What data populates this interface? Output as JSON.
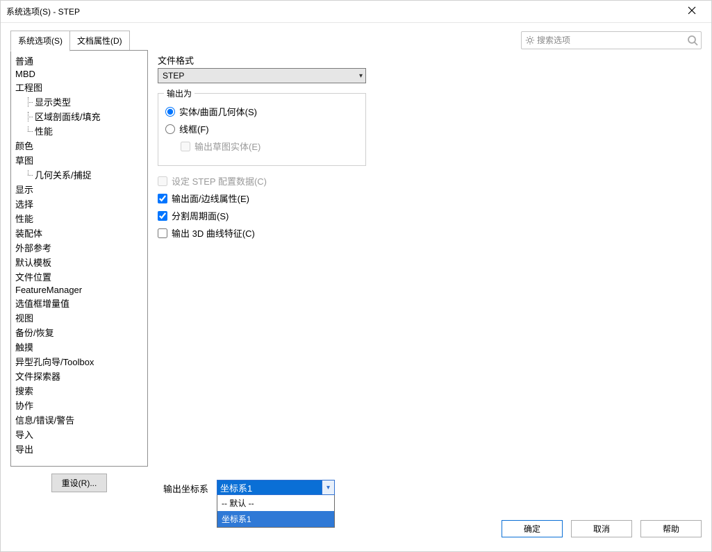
{
  "window": {
    "title": "系统选项(S) - STEP"
  },
  "tabs": {
    "system": "系统选项(S)",
    "docprops": "文档属性(D)"
  },
  "search": {
    "placeholder": "搜索选项"
  },
  "tree": {
    "items": [
      "普通",
      "MBD",
      "工程图",
      "颜色",
      "草图",
      "显示",
      "选择",
      "性能",
      "装配体",
      "外部参考",
      "默认模板",
      "文件位置",
      "FeatureManager",
      "选值框增量值",
      "视图",
      "备份/恢复",
      "触摸",
      "异型孔向导/Toolbox",
      "文件探索器",
      "搜索",
      "协作",
      "信息/错误/警告",
      "导入",
      "导出"
    ],
    "drawing_children": [
      "显示类型",
      "区域剖面线/填充",
      "性能"
    ],
    "sketch_children": [
      "几何关系/捕捉"
    ]
  },
  "reset_label": "重设(R)...",
  "main": {
    "file_format_label": "文件格式",
    "file_format_value": "STEP",
    "output_as_title": "输出为",
    "radio_solid": "实体/曲面几何体(S)",
    "radio_wire": "线框(F)",
    "check_sketch": "输出草图实体(E)",
    "check_config": "设定 STEP 配置数据(C)",
    "check_faceedge": "输出面/边线属性(E)",
    "check_split": "分割周期面(S)",
    "check_3dcurve": "输出 3D 曲线特征(C)",
    "coord_label": "输出坐标系",
    "coord_value": "坐标系1",
    "coord_options": [
      "-- 默认 --",
      "坐标系1"
    ]
  },
  "footer": {
    "ok": "确定",
    "cancel": "取消",
    "help": "帮助"
  }
}
